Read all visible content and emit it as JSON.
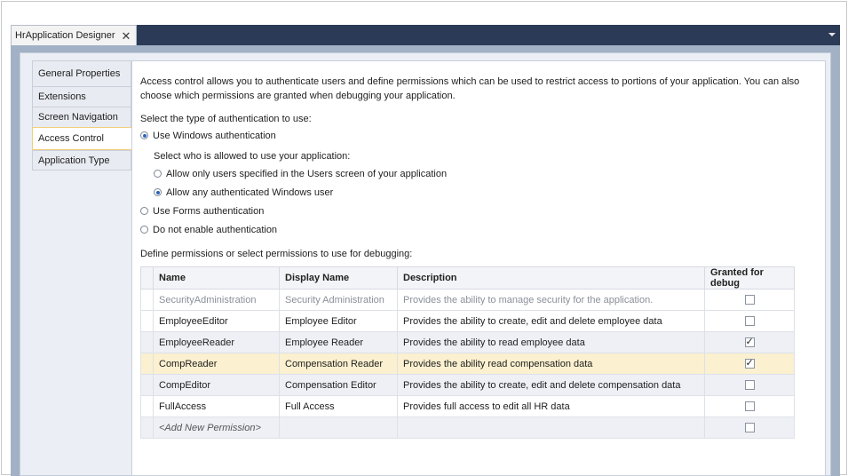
{
  "document_tab": {
    "title": "HrApplication Designer",
    "close_glyph": "✕"
  },
  "side_tabs": [
    {
      "label": "General Properties",
      "active": false
    },
    {
      "label": "Extensions",
      "active": false
    },
    {
      "label": "Screen Navigation",
      "active": false
    },
    {
      "label": "Access Control",
      "active": true
    },
    {
      "label": "Application Type",
      "active": false
    }
  ],
  "intro_text": "Access control allows you to authenticate users and define permissions which can be used to restrict access to portions of your application.  You can also choose which permissions are granted when debugging your application.",
  "auth": {
    "prompt": "Select the type of authentication to use:",
    "windows": "Use Windows authentication",
    "who_prompt": "Select who is allowed to use your application:",
    "only_specified": "Allow only users specified in the Users screen of your application",
    "any_windows": "Allow any authenticated Windows user",
    "forms": "Use Forms authentication",
    "none": "Do not enable authentication"
  },
  "permissions": {
    "prompt": "Define permissions or select permissions to use for debugging:",
    "headers": {
      "name": "Name",
      "display": "Display Name",
      "description": "Description",
      "granted": "Granted for debug"
    },
    "rows": [
      {
        "name": "SecurityAdministration",
        "display": "Security Administration",
        "description": "Provides the ability to manage security for the application.",
        "granted": false
      },
      {
        "name": "EmployeeEditor",
        "display": "Employee Editor",
        "description": "Provides the ability to create, edit and delete employee data",
        "granted": false
      },
      {
        "name": "EmployeeReader",
        "display": "Employee Reader",
        "description": "Provides the ability to read employee data",
        "granted": true
      },
      {
        "name": "CompReader",
        "display": "Compensation Reader",
        "description": "Provides the ability read compensation data",
        "granted": true
      },
      {
        "name": "CompEditor",
        "display": "Compensation Editor",
        "description": "Provides the ability to create, edit and delete compensation data",
        "granted": false
      },
      {
        "name": "FullAccess",
        "display": "Full Access",
        "description": "Provides full access to edit all HR data",
        "granted": false
      }
    ],
    "new_row": "<Add New Permission>"
  }
}
